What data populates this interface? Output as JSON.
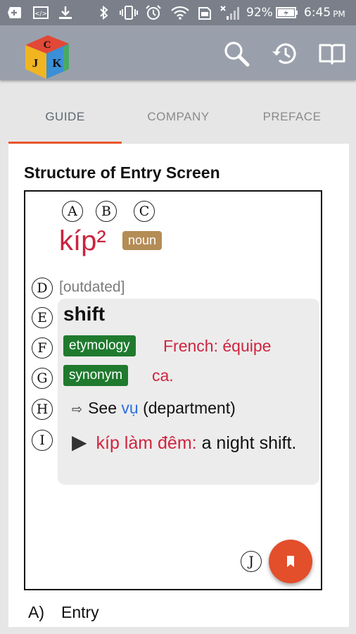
{
  "status_bar": {
    "battery_percent": "92%",
    "time": "6:45",
    "time_suffix": "PM",
    "icons": [
      "add-box-icon",
      "code-icon",
      "download-icon",
      "bluetooth-icon",
      "vibrate-icon",
      "alarm-icon",
      "wifi-icon",
      "sd-card-icon",
      "no-signal-icon",
      "battery-charging-icon"
    ]
  },
  "app_bar": {
    "logo_letters": [
      "C",
      "J",
      "K"
    ],
    "actions": [
      "search-icon",
      "history-icon",
      "book-icon"
    ]
  },
  "tabs": [
    {
      "label": "GUIDE",
      "active": true
    },
    {
      "label": "COMPANY",
      "active": false
    },
    {
      "label": "PREFACE",
      "active": false
    }
  ],
  "guide": {
    "title": "Structure of Entry Screen",
    "markers": {
      "a": "A",
      "b": "B",
      "c": "C",
      "d": "D",
      "e": "E",
      "f": "F",
      "g": "G",
      "h": "H",
      "i": "I",
      "j": "J"
    },
    "entry": {
      "headword": "kíp²",
      "part_of_speech": "noun",
      "usage_label": "[outdated]",
      "sense": {
        "meaning": "shift",
        "etymology_tag": "etymology",
        "etymology_text": "French: équipe",
        "synonym_tag": "synonym",
        "synonym_text": "ca.",
        "see_prefix": "See",
        "see_link": "vụ",
        "see_suffix": "(department)",
        "example_vi": "kíp làm đêm:",
        "example_en": "a night shift."
      }
    },
    "caption": {
      "letter": "A)",
      "label": "Entry"
    }
  },
  "colors": {
    "status_bar": "#7a7f8a",
    "app_bar": "#9aa0ab",
    "tab_indicator": "#e8552c",
    "headword": "#c9243f",
    "pos_tag": "#b48c55",
    "tag_green": "#1f7a2e",
    "link": "#2c6fe0",
    "fab": "#e34e2b"
  }
}
